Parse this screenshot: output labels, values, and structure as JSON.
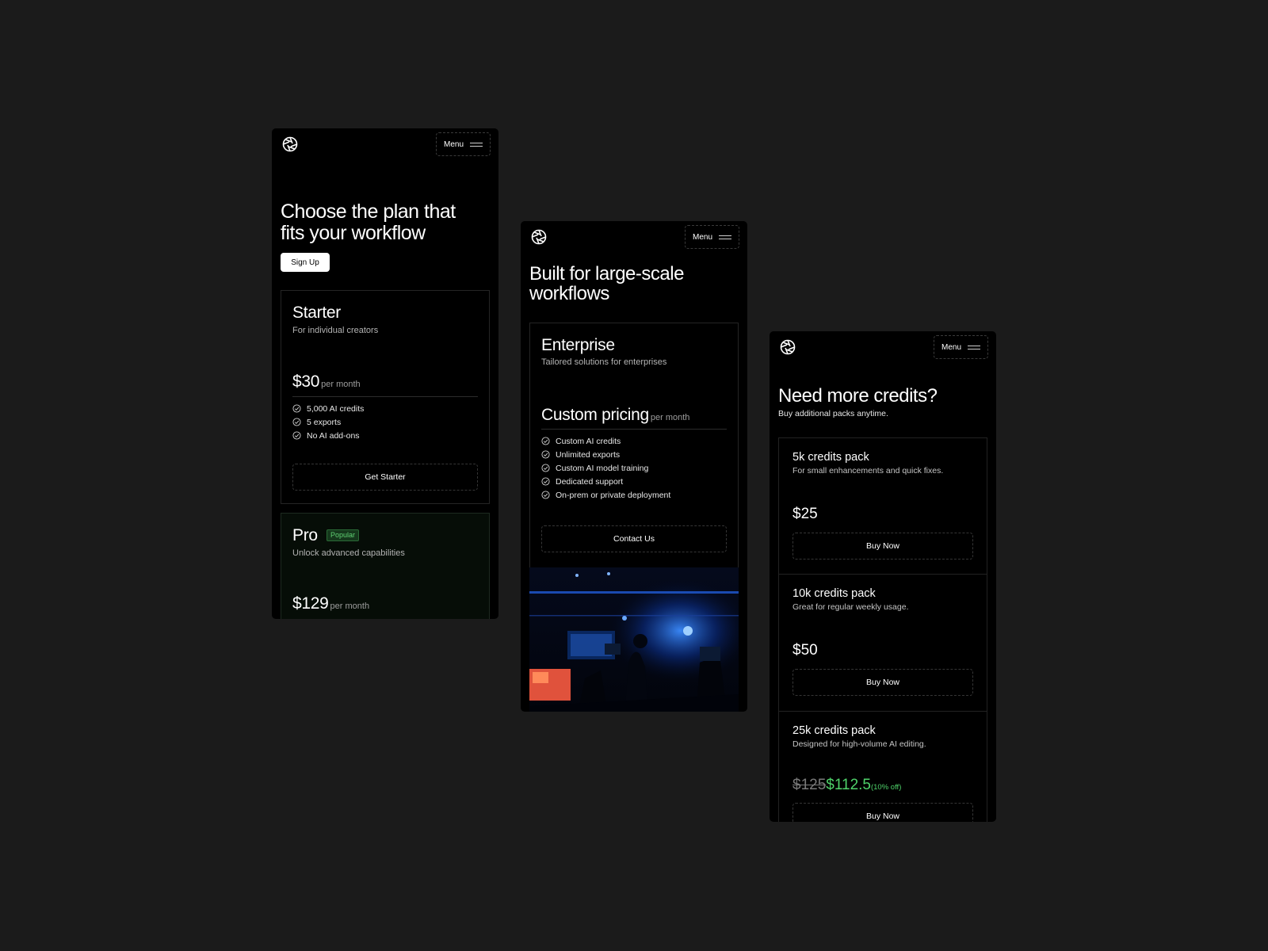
{
  "menu_label": "Menu",
  "screen1": {
    "title_line1": "Choose the plan that",
    "title_line2": "fits your workflow",
    "signup_label": "Sign Up",
    "starter": {
      "name": "Starter",
      "subtitle": "For individual creators",
      "price": "$30",
      "period": "per month",
      "features": [
        "5,000 AI credits",
        "5 exports",
        "No AI add-ons"
      ],
      "cta": "Get Starter"
    },
    "pro": {
      "name": "Pro",
      "badge": "Popular",
      "subtitle": "Unlock advanced capabilities",
      "price": "$129",
      "period": "per month"
    }
  },
  "screen2": {
    "title_line1": "Built for large-scale",
    "title_line2": "workflows",
    "enterprise": {
      "name": "Enterprise",
      "subtitle": "Tailored solutions for enterprises",
      "price": "Custom pricing",
      "period": "per month",
      "features": [
        "Custom AI credits",
        "Unlimited exports",
        "Custom AI model training",
        "Dedicated support",
        "On-prem or private deployment"
      ],
      "cta": "Contact Us"
    }
  },
  "screen3": {
    "title": "Need more credits?",
    "subtitle": "Buy additional packs anytime.",
    "packs": [
      {
        "name": "5k credits pack",
        "subtitle": "For small enhancements and quick fixes.",
        "price": "$25",
        "cta": "Buy Now"
      },
      {
        "name": "10k credits pack",
        "subtitle": "Great for regular weekly usage.",
        "price": "$50",
        "cta": "Buy Now"
      },
      {
        "name": "25k credits pack",
        "subtitle": "Designed for high-volume AI editing.",
        "old_price": "$125",
        "new_price": "$112.5",
        "discount": "(10% off)",
        "cta": "Buy Now"
      }
    ]
  },
  "colors": {
    "background": "#1b1b1b",
    "phone": "#000000",
    "accent_green": "#4fd36a",
    "badge_bg": "#15381c"
  },
  "icons": {
    "logo": "aperture-logo-icon",
    "menu": "hamburger-icon",
    "check": "check-circle-icon"
  }
}
